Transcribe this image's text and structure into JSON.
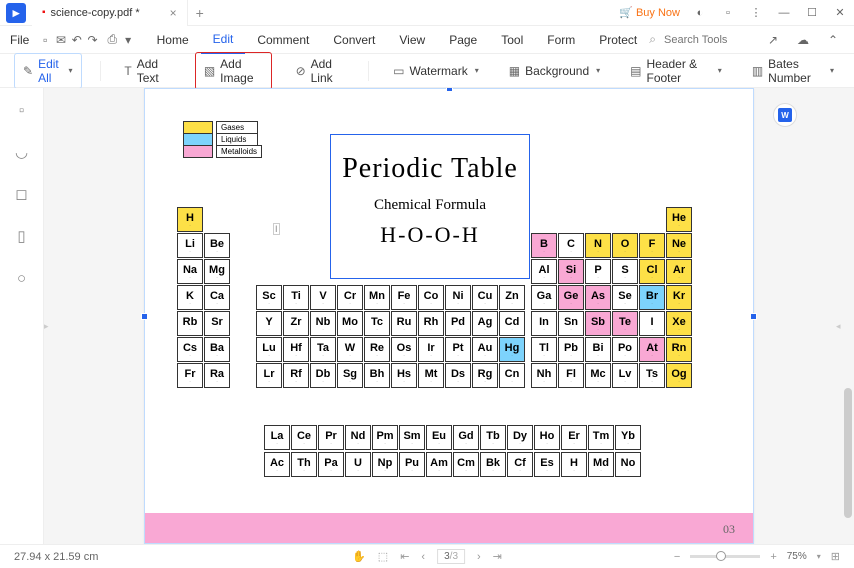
{
  "title": {
    "filename": "science-copy.pdf *"
  },
  "titlebar": {
    "buy_now": "Buy Now"
  },
  "menu": {
    "file": "File",
    "tabs": [
      "Home",
      "Edit",
      "Comment",
      "Convert",
      "View",
      "Page",
      "Tool",
      "Form",
      "Protect"
    ],
    "active_tab": 1,
    "search_placeholder": "Search Tools"
  },
  "toolbar": {
    "edit_all": "Edit All",
    "add_text": "Add Text",
    "add_image": "Add Image",
    "add_link": "Add Link",
    "watermark": "Watermark",
    "background": "Background",
    "header_footer": "Header & Footer",
    "bates": "Bates Number"
  },
  "legend": {
    "items": [
      {
        "label": "Gases",
        "class": "gas",
        "color": "#fde047"
      },
      {
        "label": "Liquids",
        "class": "liq",
        "color": "#7dd3fc"
      },
      {
        "label": "Metalloids",
        "class": "met",
        "color": "#f9a8d4"
      }
    ]
  },
  "doc": {
    "title": "Periodic Table",
    "subtitle": "Chemical Formula",
    "formula": "H-O-O-H",
    "page_num": "03"
  },
  "status": {
    "dims": "27.94 x 21.59 cm",
    "page": "3",
    "total": "/3",
    "zoom": "75%"
  },
  "chart_data": {
    "type": "table",
    "title": "Periodic Table",
    "legend": [
      "Gases",
      "Liquids",
      "Metalloids"
    ],
    "main_grid": [
      [
        "H",
        "",
        "",
        "",
        "",
        "",
        "",
        "",
        "",
        "",
        "",
        "",
        "",
        "",
        "",
        "",
        "",
        "He"
      ],
      [
        "Li",
        "Be",
        "",
        "",
        "",
        "",
        "",
        "",
        "",
        "",
        "",
        "",
        "B",
        "C",
        "N",
        "O",
        "F",
        "Ne"
      ],
      [
        "Na",
        "Mg",
        "",
        "",
        "",
        "",
        "",
        "",
        "",
        "",
        "",
        "",
        "Al",
        "Si",
        "P",
        "S",
        "Cl",
        "Ar"
      ],
      [
        "K",
        "Ca",
        "Sc",
        "Ti",
        "V",
        "Cr",
        "Mn",
        "Fe",
        "Co",
        "Ni",
        "Cu",
        "Zn",
        "Ga",
        "Ge",
        "As",
        "Se",
        "Br",
        "Kr"
      ],
      [
        "Rb",
        "Sr",
        "Y",
        "Zr",
        "Nb",
        "Mo",
        "Tc",
        "Ru",
        "Rh",
        "Pd",
        "Ag",
        "Cd",
        "In",
        "Sn",
        "Sb",
        "Te",
        "I",
        "Xe"
      ],
      [
        "Cs",
        "Ba",
        "Lu",
        "Hf",
        "Ta",
        "W",
        "Re",
        "Os",
        "Ir",
        "Pt",
        "Au",
        "Hg",
        "Tl",
        "Pb",
        "Bi",
        "Po",
        "At",
        "Rn"
      ],
      [
        "Fr",
        "Ra",
        "Lr",
        "Rf",
        "Db",
        "Sg",
        "Bh",
        "Hs",
        "Mt",
        "Ds",
        "Rg",
        "Cn",
        "Nh",
        "Fl",
        "Mc",
        "Lv",
        "Ts",
        "Og"
      ]
    ],
    "lanthanides": [
      "La",
      "Ce",
      "Pr",
      "Nd",
      "Pm",
      "Sm",
      "Eu",
      "Gd",
      "Tb",
      "Dy",
      "Ho",
      "Er",
      "Tm",
      "Yb"
    ],
    "actinides": [
      "Ac",
      "Th",
      "Pa",
      "U",
      "Np",
      "Pu",
      "Am",
      "Cm",
      "Bk",
      "Cf",
      "Es",
      "H",
      "Md",
      "No"
    ],
    "highlights": {
      "gas": [
        "H",
        "He",
        "N",
        "O",
        "F",
        "Ne",
        "Cl",
        "Ar",
        "Kr",
        "Xe",
        "Rn",
        "Og"
      ],
      "liq": [
        "Br",
        "Hg"
      ],
      "met": [
        "B",
        "Si",
        "Ge",
        "As",
        "Sb",
        "Te",
        "At"
      ]
    }
  }
}
